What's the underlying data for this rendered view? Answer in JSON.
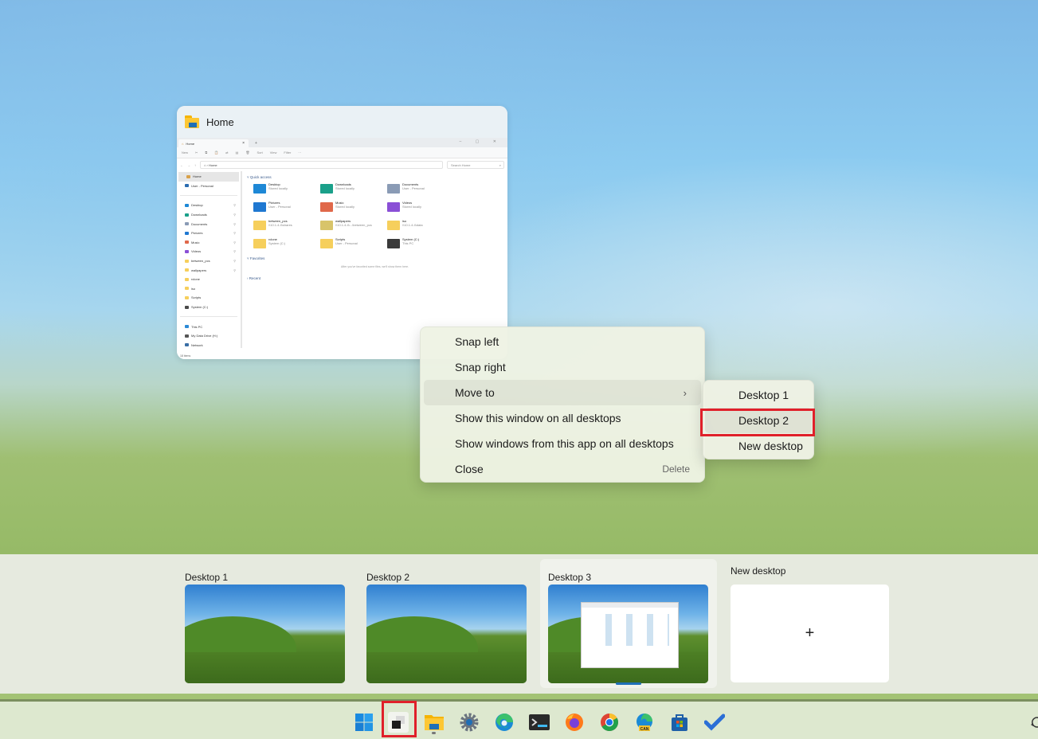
{
  "window_thumbnail": {
    "title": "Home",
    "explorer": {
      "tab_label": "Home",
      "tab_close": "×",
      "tab_add": "+",
      "window_controls": "– ▢ ✕",
      "command_bar": [
        "New",
        "✂",
        "⧉",
        "📋",
        "⇄",
        "▤",
        "🗑",
        "Sort",
        "View",
        "Filter",
        "···"
      ],
      "address": "⌂ › Home",
      "search_placeholder": "Search Home",
      "nav_items": [
        {
          "label": "Home",
          "selected": true
        },
        {
          "label": "User - Personal"
        },
        {
          "label": "Desktop",
          "pinned": true
        },
        {
          "label": "Downloads",
          "pinned": true
        },
        {
          "label": "Documents",
          "pinned": true
        },
        {
          "label": "Pictures",
          "pinned": true
        },
        {
          "label": "Music",
          "pinned": true
        },
        {
          "label": "Videos",
          "pinned": true
        },
        {
          "label": "between_pcs",
          "pinned": true
        },
        {
          "label": "wallpapers",
          "pinned": true
        },
        {
          "label": "rclone"
        },
        {
          "label": "iso"
        },
        {
          "label": "Scripts"
        },
        {
          "label": "System (C:)"
        },
        {
          "label": "This PC"
        },
        {
          "label": "My Data Drive (H:)"
        },
        {
          "label": "Network"
        }
      ],
      "sections": {
        "quick_access": "Quick access",
        "favorites": "Favorites",
        "favorites_empty": "After you've favorited some files, we'll show them here.",
        "recent": "Recent"
      },
      "quick_access_items": [
        {
          "name": "Desktop",
          "sub": "Stored locally",
          "color": "#1e88d6"
        },
        {
          "name": "Downloads",
          "sub": "Stored locally",
          "color": "#1aa08a"
        },
        {
          "name": "Documents",
          "sub": "User - Personal",
          "color": "#8a9bb5"
        },
        {
          "name": "Pictures",
          "sub": "User - Personal",
          "color": "#1f78d1"
        },
        {
          "name": "Music",
          "sub": "Stored locally",
          "color": "#e0684a"
        },
        {
          "name": "Videos",
          "sub": "Stored locally",
          "color": "#8a4fd6"
        },
        {
          "name": "between_pcs",
          "sub": "\\\\10.1.4.4\\shares",
          "color": "#f6cf5c"
        },
        {
          "name": "wallpapers",
          "sub": "\\\\10.1.4.4\\...\\between_pcs",
          "color": "#d8c46a"
        },
        {
          "name": "iso",
          "sub": "\\\\10.1.4.4\\data",
          "color": "#f6cf5c"
        },
        {
          "name": "rclone",
          "sub": "System (C:)",
          "color": "#f6cf5c"
        },
        {
          "name": "Scripts",
          "sub": "User - Personal",
          "color": "#f6cf5c"
        },
        {
          "name": "System (C:)",
          "sub": "This PC",
          "color": "#3a3a3a"
        }
      ],
      "status": "18 items"
    }
  },
  "context_menu": {
    "items": [
      {
        "label": "Snap left"
      },
      {
        "label": "Snap right"
      },
      {
        "label": "Move to",
        "submenu": true,
        "chevron": "›"
      },
      {
        "label": "Show this window on all desktops"
      },
      {
        "label": "Show windows from this app on all desktops"
      },
      {
        "label": "Close",
        "accelerator": "Delete"
      }
    ],
    "submenu": {
      "items": [
        {
          "label": "Desktop 1"
        },
        {
          "label": "Desktop 2",
          "highlighted": true
        },
        {
          "label": "New desktop"
        }
      ]
    }
  },
  "desktops": {
    "items": [
      {
        "label": "Desktop 1"
      },
      {
        "label": "Desktop 2"
      },
      {
        "label": "Desktop 3",
        "active": true
      }
    ],
    "new_desktop_label": "New desktop",
    "new_desktop_glyph": "+"
  },
  "taskbar": {
    "icons": [
      "start",
      "task-view",
      "file-explorer",
      "settings",
      "edge",
      "terminal",
      "firefox",
      "chrome",
      "edge-canary",
      "microsoft-store",
      "todo"
    ],
    "canary_badge": "CAN"
  },
  "colors": {
    "highlight_red": "#e0202a",
    "accent_blue": "#1f6fb6"
  }
}
